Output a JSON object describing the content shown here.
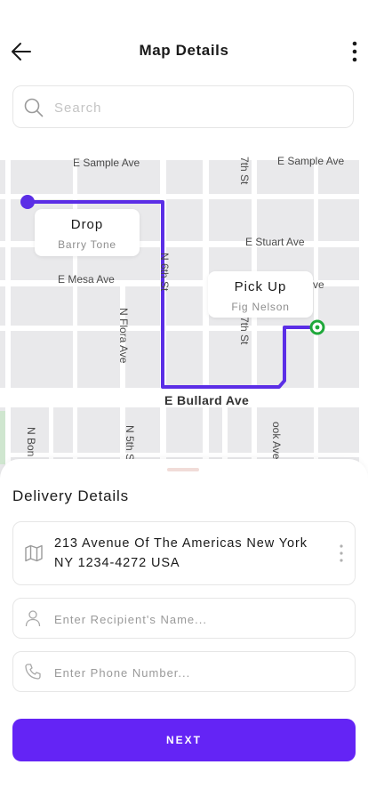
{
  "header": {
    "title": "Map Details",
    "back_icon": "arrow-left-icon",
    "menu_icon": "more-vertical-icon"
  },
  "search": {
    "placeholder": "Search",
    "value": ""
  },
  "map": {
    "streets": {
      "e_sample_ave_1": "E Sample Ave",
      "e_sample_ave_2": "E Sample Ave",
      "seventh_st_top": "7th St",
      "e_stuart_ave": "E Stuart Ave",
      "e_mesa_ave": "E Mesa Ave",
      "n_6th_st": "N 6th St",
      "n_flora_ave": "N Flora Ave",
      "n_7th_st": "N 7th St",
      "ave_partial": "ve",
      "e_bullard_ave": "E Bullard Ave",
      "n_bon_partial": "N Bon",
      "n_5th_partial": "N 5th S",
      "ook_ave_partial": "ook Ave"
    },
    "drop": {
      "title": "Drop",
      "subtitle": "Barry Tone"
    },
    "pickup": {
      "title": "Pick Up",
      "subtitle": "Fig Nelson"
    },
    "colors": {
      "route": "#5b2ee6",
      "pickup_marker": "#1fa83a",
      "drop_marker": "#5b2ee6"
    }
  },
  "delivery": {
    "title": "Delivery Details",
    "address": "213 Avenue Of The Americas New York NY 1234-4272 USA",
    "recipient_placeholder": "Enter Recipient's Name...",
    "phone_placeholder": "Enter Phone Number...",
    "next_label": "NEXT"
  },
  "colors": {
    "accent": "#6424f5",
    "border": "#e6e6e6"
  }
}
